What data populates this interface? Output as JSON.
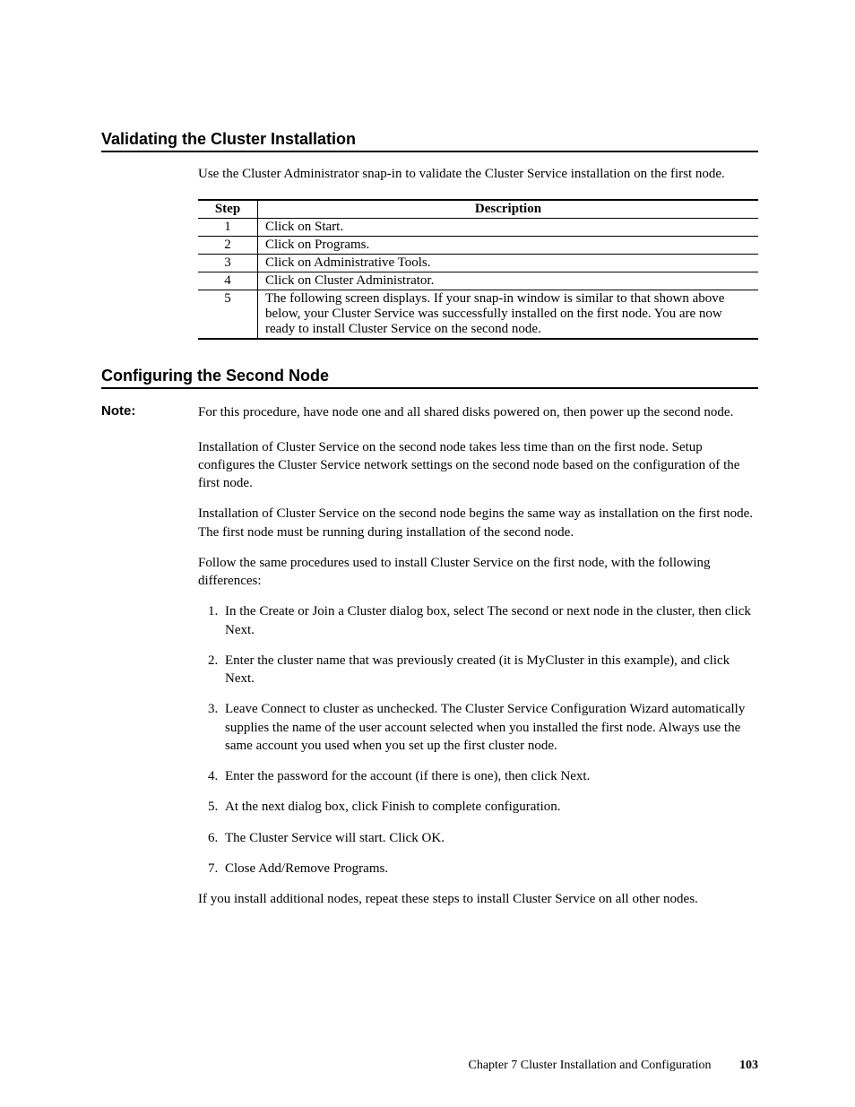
{
  "section1": {
    "heading": "Validating the Cluster Installation",
    "intro": "Use the Cluster Administrator snap-in to validate the Cluster Service installation on the first node.",
    "table": {
      "headers": {
        "step": "Step",
        "desc": "Description"
      },
      "rows": [
        {
          "step": "1",
          "desc": "Click on Start."
        },
        {
          "step": "2",
          "desc": "Click on Programs."
        },
        {
          "step": "3",
          "desc": "Click on Administrative Tools."
        },
        {
          "step": "4",
          "desc": "Click on Cluster Administrator."
        },
        {
          "step": "5",
          "desc": "The following screen displays. If your snap-in window is similar to that shown above below, your Cluster Service was successfully installed on the first node. You are now ready to install Cluster Service on the second node."
        }
      ]
    }
  },
  "section2": {
    "heading": "Configuring the Second Node",
    "note_label": "Note:",
    "note_text": "For this procedure, have node one and all shared disks powered on, then power up the second node.",
    "p1": "Installation of Cluster Service on the second node takes less time than on the first node. Setup configures the Cluster Service network settings on the second node based on the configuration of the first node.",
    "p2": "Installation of Cluster Service on the second node begins the same way as installation on the first node. The first node must be running during installation of the second node.",
    "p3": "Follow the same procedures used to install Cluster Service on the first node, with the following differences:",
    "list": [
      "In the Create or Join a Cluster dialog box, select The second or next node in the cluster, then click Next.",
      "Enter the cluster name that was previously created (it is MyCluster in this example), and click Next.",
      "Leave Connect to cluster as unchecked. The Cluster Service Configuration Wizard automatically supplies the name of the user account selected when you installed the first node. Always use the same account you used when you set up the first cluster node.",
      "Enter the password for the account (if there is one), then click Next.",
      "At the next dialog box, click Finish to complete configuration.",
      "The Cluster Service will start. Click OK.",
      "Close Add/Remove Programs."
    ],
    "p4": "If you install additional nodes, repeat these steps to install Cluster Service on all other nodes."
  },
  "footer": {
    "chapter": "Chapter 7 Cluster Installation and Configuration",
    "page": "103"
  }
}
